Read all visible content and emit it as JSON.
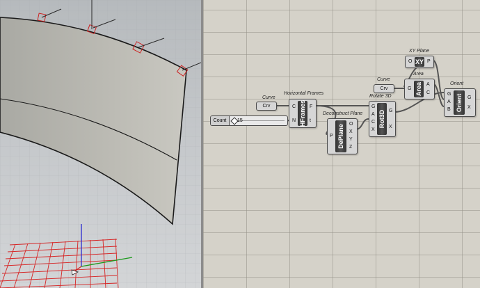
{
  "slider": {
    "label": "Count",
    "value": "15",
    "fraction": 0.15
  },
  "components": {
    "curve1": {
      "title": "Curve",
      "label": "Crv"
    },
    "hframes": {
      "title": "Horizontal Frames",
      "name": "HFrames",
      "in": [
        "C",
        "N"
      ],
      "out": [
        "F",
        "t"
      ]
    },
    "deplane": {
      "title": "Deconstruct Plane",
      "name": "DePlane",
      "in": [
        "P"
      ],
      "out": [
        "O",
        "X",
        "Y",
        "Z"
      ]
    },
    "rot3d": {
      "title": "Rotate 3D",
      "name": "Rot3D",
      "in": [
        "G",
        "A",
        "C",
        "X"
      ],
      "out": [
        "G",
        "X"
      ]
    },
    "curve2": {
      "title": "Curve",
      "label": "Crv"
    },
    "xyplane": {
      "title": "XY Plane",
      "name": "XY",
      "in": [
        "O"
      ],
      "out": [
        "P"
      ]
    },
    "area": {
      "title": "Area",
      "name": "Area",
      "in": [
        "G"
      ],
      "out": [
        "A",
        "C"
      ]
    },
    "orient": {
      "title": "Orient",
      "name": "Orient",
      "in": [
        "G",
        "A",
        "B"
      ],
      "out": [
        "G",
        "X"
      ]
    }
  },
  "colors": {
    "canvas": "#d5d2c9",
    "viewport_bg": "#c4c7ca",
    "surface": "#b7b6ae",
    "frame_marker": "#cc2222",
    "grid_red": "#d62424"
  },
  "icons": [
    "axis-gizmo-icon"
  ]
}
